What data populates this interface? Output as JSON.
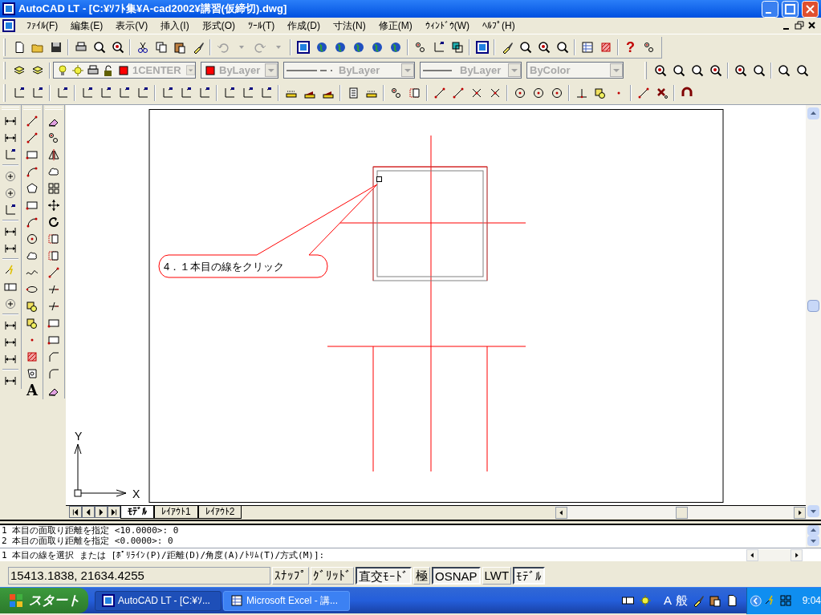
{
  "window": {
    "title": "AutoCAD LT - [C:¥ｿﾌﾄ集¥A-cad2002¥講習(仮締切).dwg]"
  },
  "menu": [
    "ﾌｧｲﾙ(F)",
    "編集(E)",
    "表示(V)",
    "挿入(I)",
    "形式(O)",
    "ﾂｰﾙ(T)",
    "作成(D)",
    "寸法(N)",
    "修正(M)",
    "ｳｨﾝﾄﾞｳ(W)",
    "ﾍﾙﾌﾟ(H)"
  ],
  "standard_toolbar": {
    "help_glyph": "?"
  },
  "properties_toolbar": {
    "layer": "1CENTER",
    "color_setting": "ByLayer",
    "linetype": "ByLayer",
    "lineweight": "ByLayer",
    "plot_style": "ByColor"
  },
  "draw_toolbar": {
    "text_tool_glyph": "A"
  },
  "drawing": {
    "callout": "4．１本目の線をクリック",
    "axis_x": "X",
    "axis_y": "Y"
  },
  "layout_tabs": [
    {
      "label": "ﾓﾃﾞﾙ",
      "selected": true
    },
    {
      "label": "ﾚｲｱｳﾄ1",
      "selected": false
    },
    {
      "label": "ﾚｲｱｳﾄ2",
      "selected": false
    }
  ],
  "command_history": [
    "1 本目の面取り距離を指定 <10.0000>: 0",
    "2 本目の面取り距離を指定 <0.0000>: 0"
  ],
  "command_prompt": "1 本目の線を選択 または [ﾎﾟﾘﾗｲﾝ(P)/距離(D)/角度(A)/ﾄﾘﾑ(T)/方式(M)]:",
  "status_bar": {
    "coordinates": "15413.1838, 21634.4255",
    "toggles": [
      {
        "label": "ｽﾅｯﾌﾟ",
        "on": false
      },
      {
        "label": "ｸﾞﾘｯﾄﾞ",
        "on": false
      },
      {
        "label": "直交ﾓｰﾄﾞ",
        "on": true
      },
      {
        "label": "極",
        "on": false
      },
      {
        "label": "OSNAP",
        "on": true
      },
      {
        "label": "LWT",
        "on": false
      },
      {
        "label": "ﾓﾃﾞﾙ",
        "on": true
      }
    ]
  },
  "taskbar": {
    "start": "スタート",
    "tasks": [
      {
        "label": "AutoCAD LT - [C:¥ｿ...",
        "selected": true
      },
      {
        "label": "Microsoft Excel - 講...",
        "selected": false
      }
    ],
    "ime_mode": "A",
    "ime_kana": "般",
    "clock": "9:04"
  }
}
